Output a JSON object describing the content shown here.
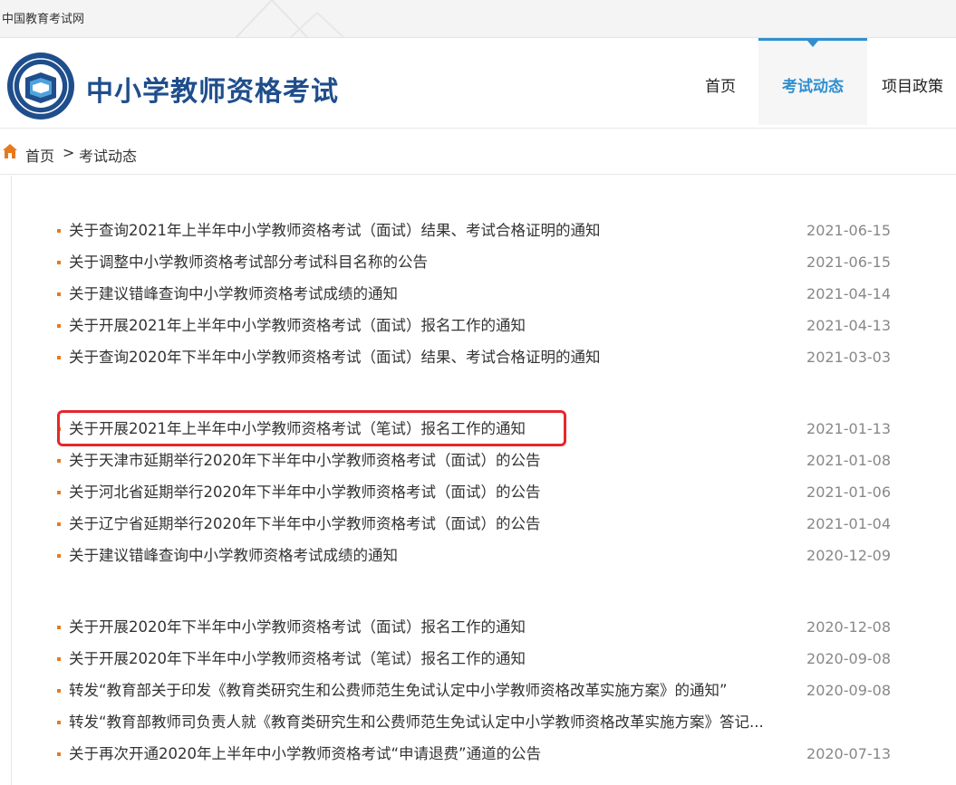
{
  "topbar": {
    "site_name": "中国教育考试网"
  },
  "header": {
    "title": "中小学教师资格考试",
    "nav": {
      "home": "首页",
      "exam_news": "考试动态",
      "policy": "项目政策"
    }
  },
  "breadcrumb": {
    "home": "首页",
    "separator": ">",
    "current": "考试动态"
  },
  "groups": [
    [
      {
        "title": "关于查询2021年上半年中小学教师资格考试（面试）结果、考试合格证明的通知",
        "date": "2021-06-15"
      },
      {
        "title": "关于调整中小学教师资格考试部分考试科目名称的公告",
        "date": "2021-06-15"
      },
      {
        "title": "关于建议错峰查询中小学教师资格考试成绩的通知",
        "date": "2021-04-14"
      },
      {
        "title": "关于开展2021年上半年中小学教师资格考试（面试）报名工作的通知",
        "date": "2021-04-13"
      },
      {
        "title": "关于查询2020年下半年中小学教师资格考试（面试）结果、考试合格证明的通知",
        "date": "2021-03-03"
      }
    ],
    [
      {
        "title": "关于开展2021年上半年中小学教师资格考试（笔试）报名工作的通知",
        "date": "2021-01-13"
      },
      {
        "title": "关于天津市延期举行2020年下半年中小学教师资格考试（面试）的公告",
        "date": "2021-01-08"
      },
      {
        "title": "关于河北省延期举行2020年下半年中小学教师资格考试（面试）的公告",
        "date": "2021-01-06"
      },
      {
        "title": "关于辽宁省延期举行2020年下半年中小学教师资格考试（面试）的公告",
        "date": "2021-01-04"
      },
      {
        "title": "关于建议错峰查询中小学教师资格考试成绩的通知",
        "date": "2020-12-09"
      }
    ],
    [
      {
        "title": "关于开展2020年下半年中小学教师资格考试（面试）报名工作的通知",
        "date": "2020-12-08"
      },
      {
        "title": "关于开展2020年下半年中小学教师资格考试（笔试）报名工作的通知",
        "date": "2020-09-08"
      },
      {
        "title": "转发“教育部关于印发《教育类研究生和公费师范生免试认定中小学教师资格改革实施方案》的通知”",
        "date": "2020-09-08"
      },
      {
        "title": "转发“教育部教师司负责人就《教育类研究生和公费师范生免试认定中小学教师资格改革实施方案》答记...",
        "date": ""
      },
      {
        "title": "关于再次开通2020年上半年中小学教师资格考试“申请退费”通道的公告",
        "date": "2020-07-13"
      }
    ]
  ],
  "colors": {
    "accent": "#2f8fd1",
    "bullet": "#e8791e",
    "highlight": "#e5282b",
    "title": "#1f4e8c"
  }
}
